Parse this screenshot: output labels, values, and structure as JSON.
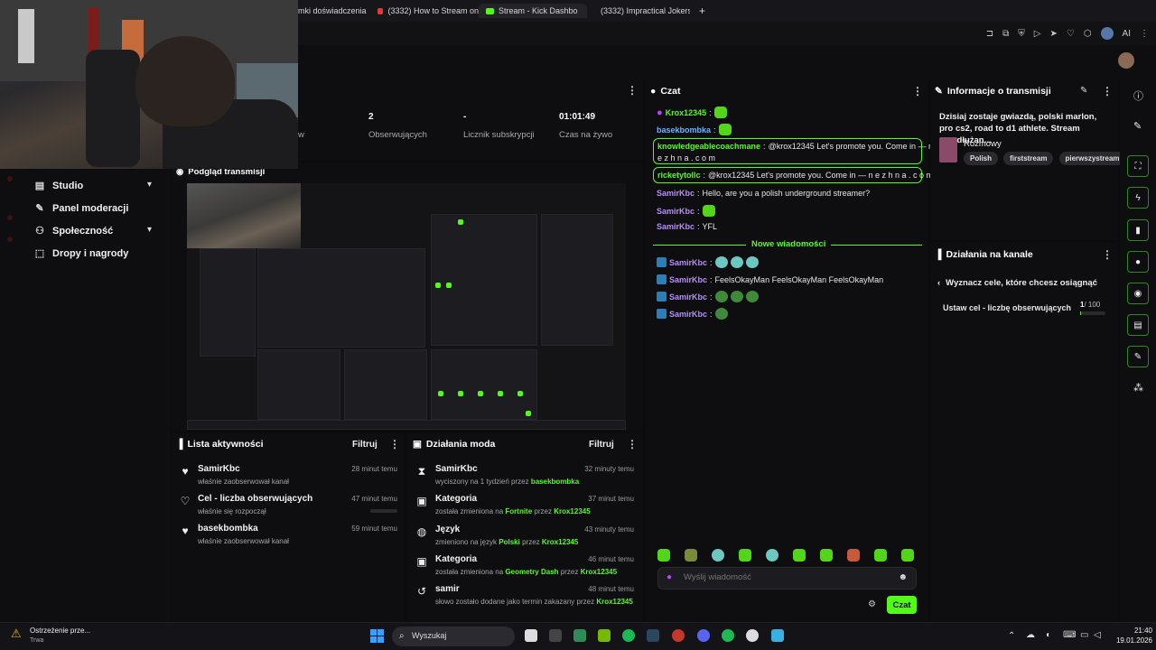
{
  "browser": {
    "tabs": [
      {
        "label": "mki doświadczenia",
        "icon": "none"
      },
      {
        "label": "(3332) How to Stream on",
        "icon": "youtube"
      },
      {
        "label": "Stream - Kick Dashbo",
        "icon": "kick"
      },
      {
        "label": "(3332) Impractical Jokers",
        "icon": "youtube"
      }
    ],
    "new_tab": "+",
    "ai_label": "AI"
  },
  "sidebar": {
    "items": [
      {
        "label": "Studio",
        "icon": "studio-icon",
        "chevron": "▾"
      },
      {
        "label": "Panel moderacji",
        "icon": "wrench-icon"
      },
      {
        "label": "Społeczność",
        "icon": "community-icon",
        "chevron": "▾"
      },
      {
        "label": "Dropy i nagrody",
        "icon": "drops-icon"
      }
    ]
  },
  "stats": [
    {
      "value": "",
      "label": "w"
    },
    {
      "value": "2",
      "label": "Obserwujących"
    },
    {
      "value": "-",
      "label": "Licznik subskrypcji"
    },
    {
      "value": "01:01:49",
      "label": "Czas na żywo"
    }
  ],
  "preview": {
    "title": "Podgląd transmisji"
  },
  "activity": {
    "title": "Lista aktywności",
    "filter": "Filtruj",
    "items": [
      {
        "icon": "heart-filled-icon",
        "title": "SamirKbc",
        "sub": "właśnie zaobserwował kanał",
        "time": "28 minut temu"
      },
      {
        "icon": "heart-outline-icon",
        "title": "Cel - liczba obserwujących",
        "sub": "właśnie się rozpoczął",
        "time": "47 minut temu",
        "progress": 0
      },
      {
        "icon": "heart-filled-icon",
        "title": "basekbombka",
        "sub": "właśnie zaobserwował kanał",
        "time": "59 minut temu"
      }
    ]
  },
  "mod": {
    "title": "Działania moda",
    "filter": "Filtruj",
    "items": [
      {
        "icon": "hourglass-icon",
        "title": "SamirKbc",
        "sub_pre": "wyciszony na 1 tydzień przez",
        "sub_hl": "basekbombka",
        "sub_mid": "",
        "sub_hl2": "",
        "time": "32 minuty temu"
      },
      {
        "icon": "category-icon",
        "title": "Kategoria",
        "sub_pre": "została zmieniona na",
        "sub_hl": "Fortnite",
        "sub_mid": "przez",
        "sub_hl2": "Krox12345",
        "time": "37 minut temu"
      },
      {
        "icon": "globe-icon",
        "title": "Język",
        "sub_pre": "zmieniono na język",
        "sub_hl": "Polski",
        "sub_mid": "przez",
        "sub_hl2": "Krox12345",
        "time": "43 minuty temu"
      },
      {
        "icon": "category-icon",
        "title": "Kategoria",
        "sub_pre": "została zmieniona na",
        "sub_hl": "Geometry Dash",
        "sub_mid": "przez",
        "sub_hl2": "Krox12345",
        "time": "46 minut temu"
      },
      {
        "icon": "history-icon",
        "title": "samir",
        "sub_pre": "słowo zostało dodane jako termin zakazany przez",
        "sub_hl": "Krox12345",
        "sub_mid": "",
        "sub_hl2": "",
        "time": "48 minut temu"
      }
    ]
  },
  "chat": {
    "title": "Czat",
    "messages": [
      {
        "user": "Krox12345",
        "color": "green",
        "text": "",
        "emotes": 1,
        "badge": "mic"
      },
      {
        "user": "basekbombka",
        "color": "blue",
        "text": "",
        "emotes": 1
      },
      {
        "user": "knowledgeablecoachmane",
        "color": "green",
        "text": "@krox12345 Let's promote you. Come in — n",
        "text2": "e z h n a . c o m",
        "highlight": true
      },
      {
        "user": "ricketytollc",
        "color": "green",
        "text": "@krox12345 Let's promote you. Come in — n e z h n a . c o m",
        "highlight": true
      },
      {
        "user": "SamirKbc",
        "color": "purple",
        "text": "Hello, are you a polish underground streamer?"
      },
      {
        "user": "SamirKbc",
        "color": "purple",
        "text": "",
        "emotes": 1
      },
      {
        "user": "SamirKbc",
        "color": "purple",
        "text": "YFL"
      }
    ],
    "new_messages_label": "Nowe wiadomości",
    "new_messages": [
      {
        "user": "SamirKbc",
        "text": "",
        "emote_count": 3,
        "emote_style": "cyan"
      },
      {
        "user": "SamirKbc",
        "text": "FeelsOkayMan FeelsOkayMan FeelsOkayMan"
      },
      {
        "user": "SamirKbc",
        "text": "",
        "emote_count": 3,
        "emote_style": "frog"
      },
      {
        "user": "SamirKbc",
        "text": "",
        "emote_count": 1,
        "emote_style": "frog"
      }
    ],
    "input_placeholder": "Wyślij wiadomość",
    "send_label": "Czat"
  },
  "info": {
    "title": "Informacje o transmisji",
    "stream_title": "Dzisiaj zostaje gwiazdą, polski marlon, pro cs2, road to d1 athlete. Stream przedłużan...",
    "category": "Rozmowy",
    "tags": [
      "Polish",
      "firststream",
      "pierwszystream"
    ]
  },
  "actions": {
    "title": "Działania na kanale",
    "goal_header": "Wyznacz cele, które chcesz osiągnąć",
    "goal_label": "Ustaw cel - liczbę obserwujących",
    "goal_current": "1",
    "goal_total": "/ 100",
    "goal_progress": 0.01
  },
  "taskbar": {
    "notification_title": "Ostrzeżenie prze...",
    "notification_sub": "Trwa",
    "search_label": "Wyszukaj",
    "time": "21:40",
    "date": "19.01.2026"
  },
  "colors": {
    "accent": "#53fc18",
    "bg": "#0e0e10"
  }
}
